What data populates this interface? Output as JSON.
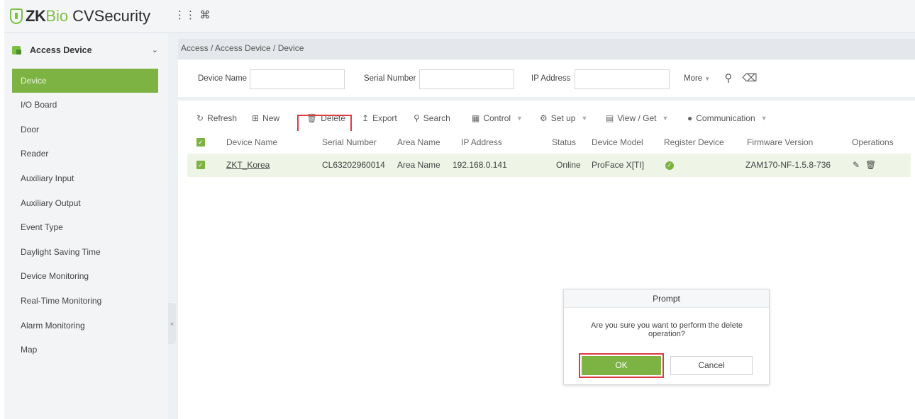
{
  "app": {
    "logo": {
      "zk": "ZK",
      "bio": "Bio",
      "name": "CVSecurity"
    },
    "top_icons": [
      "apps-grid-icon",
      "command-icon"
    ]
  },
  "colors": {
    "accent": "#7cb342",
    "highlight": "#e0393e",
    "online": "#9ccc65"
  },
  "sidebar": {
    "module": "Access Device",
    "items": [
      {
        "label": "Device",
        "active": true
      },
      {
        "label": "I/O Board"
      },
      {
        "label": "Door"
      },
      {
        "label": "Reader"
      },
      {
        "label": "Auxiliary Input"
      },
      {
        "label": "Auxiliary Output"
      },
      {
        "label": "Event Type"
      },
      {
        "label": "Daylight Saving Time"
      },
      {
        "label": "Device Monitoring"
      },
      {
        "label": "Real-Time Monitoring"
      },
      {
        "label": "Alarm Monitoring"
      },
      {
        "label": "Map"
      }
    ],
    "collapse_glyph": "«"
  },
  "breadcrumb": "Access / Access Device / Device",
  "filters": {
    "device_name_label": "Device Name",
    "device_name_value": "",
    "serial_number_label": "Serial Number",
    "serial_number_value": "",
    "ip_address_label": "IP Address",
    "ip_address_value": "",
    "more_label": "More"
  },
  "toolbar": {
    "refresh": "Refresh",
    "new": "New",
    "delete": "Delete",
    "export": "Export",
    "search": "Search",
    "control": "Control",
    "setup": "Set up",
    "view_get": "View / Get",
    "communication": "Communication"
  },
  "table": {
    "columns": [
      "Device Name",
      "Serial Number",
      "Area Name",
      "IP Address",
      "Status",
      "Device Model",
      "Register Device",
      "Firmware Version",
      "Operations"
    ],
    "rows": [
      {
        "checked": true,
        "device_name": "ZKT_Korea",
        "serial_number": "CL63202960014",
        "area_name": "Area Name",
        "ip_address": "192.168.0.141",
        "status": "Online",
        "device_model": "ProFace X[TI]",
        "register_device": true,
        "firmware_version": "ZAM170-NF-1.5.8-736"
      }
    ]
  },
  "dialog": {
    "title": "Prompt",
    "message": "Are you sure you want to perform the delete operation?",
    "ok_label": "OK",
    "cancel_label": "Cancel"
  }
}
